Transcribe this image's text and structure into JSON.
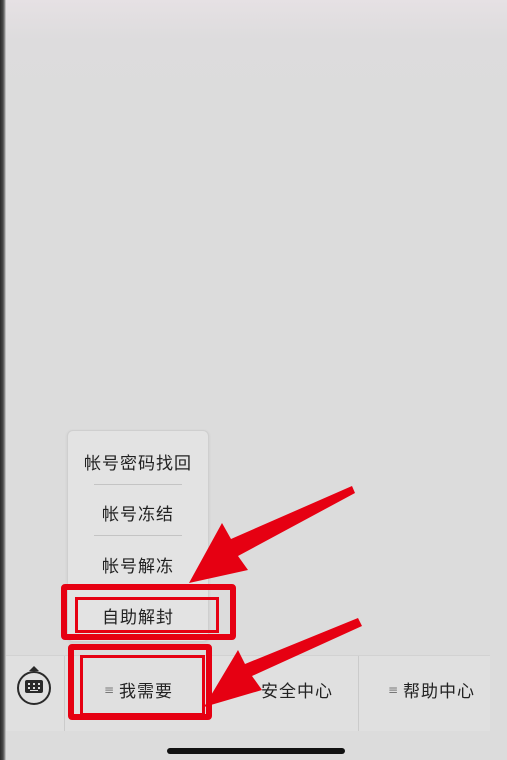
{
  "popup_menu": {
    "items": [
      {
        "label": "帐号密码找回"
      },
      {
        "label": "帐号冻结"
      },
      {
        "label": "帐号解冻"
      },
      {
        "label": "自助解封"
      }
    ]
  },
  "bottom_bar": {
    "keyboard_icon": "keyboard-toggle-icon",
    "menu_icon_glyph": "≡",
    "items": [
      {
        "label": "我需要"
      },
      {
        "label": "安全中心"
      },
      {
        "label": "帮助中心"
      }
    ]
  },
  "annotation": {
    "color": "#e60012"
  }
}
